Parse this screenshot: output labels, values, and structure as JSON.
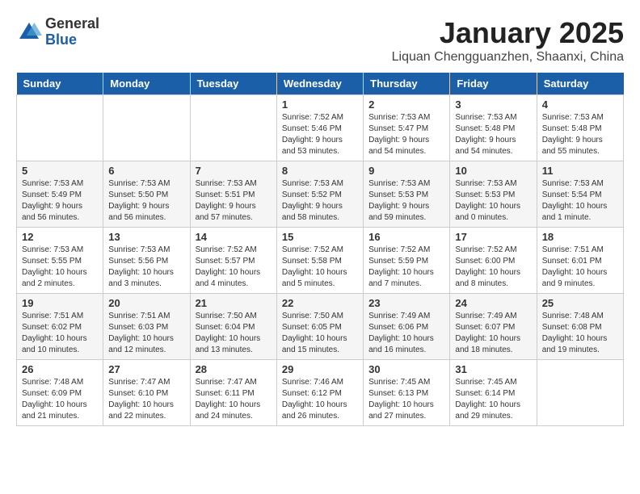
{
  "logo": {
    "general": "General",
    "blue": "Blue"
  },
  "title": "January 2025",
  "subtitle": "Liquan Chengguanzhen, Shaanxi, China",
  "headers": [
    "Sunday",
    "Monday",
    "Tuesday",
    "Wednesday",
    "Thursday",
    "Friday",
    "Saturday"
  ],
  "weeks": [
    [
      {
        "day": "",
        "info": ""
      },
      {
        "day": "",
        "info": ""
      },
      {
        "day": "",
        "info": ""
      },
      {
        "day": "1",
        "info": "Sunrise: 7:52 AM\nSunset: 5:46 PM\nDaylight: 9 hours\nand 53 minutes."
      },
      {
        "day": "2",
        "info": "Sunrise: 7:53 AM\nSunset: 5:47 PM\nDaylight: 9 hours\nand 54 minutes."
      },
      {
        "day": "3",
        "info": "Sunrise: 7:53 AM\nSunset: 5:48 PM\nDaylight: 9 hours\nand 54 minutes."
      },
      {
        "day": "4",
        "info": "Sunrise: 7:53 AM\nSunset: 5:48 PM\nDaylight: 9 hours\nand 55 minutes."
      }
    ],
    [
      {
        "day": "5",
        "info": "Sunrise: 7:53 AM\nSunset: 5:49 PM\nDaylight: 9 hours\nand 56 minutes."
      },
      {
        "day": "6",
        "info": "Sunrise: 7:53 AM\nSunset: 5:50 PM\nDaylight: 9 hours\nand 56 minutes."
      },
      {
        "day": "7",
        "info": "Sunrise: 7:53 AM\nSunset: 5:51 PM\nDaylight: 9 hours\nand 57 minutes."
      },
      {
        "day": "8",
        "info": "Sunrise: 7:53 AM\nSunset: 5:52 PM\nDaylight: 9 hours\nand 58 minutes."
      },
      {
        "day": "9",
        "info": "Sunrise: 7:53 AM\nSunset: 5:53 PM\nDaylight: 9 hours\nand 59 minutes."
      },
      {
        "day": "10",
        "info": "Sunrise: 7:53 AM\nSunset: 5:53 PM\nDaylight: 10 hours\nand 0 minutes."
      },
      {
        "day": "11",
        "info": "Sunrise: 7:53 AM\nSunset: 5:54 PM\nDaylight: 10 hours\nand 1 minute."
      }
    ],
    [
      {
        "day": "12",
        "info": "Sunrise: 7:53 AM\nSunset: 5:55 PM\nDaylight: 10 hours\nand 2 minutes."
      },
      {
        "day": "13",
        "info": "Sunrise: 7:53 AM\nSunset: 5:56 PM\nDaylight: 10 hours\nand 3 minutes."
      },
      {
        "day": "14",
        "info": "Sunrise: 7:52 AM\nSunset: 5:57 PM\nDaylight: 10 hours\nand 4 minutes."
      },
      {
        "day": "15",
        "info": "Sunrise: 7:52 AM\nSunset: 5:58 PM\nDaylight: 10 hours\nand 5 minutes."
      },
      {
        "day": "16",
        "info": "Sunrise: 7:52 AM\nSunset: 5:59 PM\nDaylight: 10 hours\nand 7 minutes."
      },
      {
        "day": "17",
        "info": "Sunrise: 7:52 AM\nSunset: 6:00 PM\nDaylight: 10 hours\nand 8 minutes."
      },
      {
        "day": "18",
        "info": "Sunrise: 7:51 AM\nSunset: 6:01 PM\nDaylight: 10 hours\nand 9 minutes."
      }
    ],
    [
      {
        "day": "19",
        "info": "Sunrise: 7:51 AM\nSunset: 6:02 PM\nDaylight: 10 hours\nand 10 minutes."
      },
      {
        "day": "20",
        "info": "Sunrise: 7:51 AM\nSunset: 6:03 PM\nDaylight: 10 hours\nand 12 minutes."
      },
      {
        "day": "21",
        "info": "Sunrise: 7:50 AM\nSunset: 6:04 PM\nDaylight: 10 hours\nand 13 minutes."
      },
      {
        "day": "22",
        "info": "Sunrise: 7:50 AM\nSunset: 6:05 PM\nDaylight: 10 hours\nand 15 minutes."
      },
      {
        "day": "23",
        "info": "Sunrise: 7:49 AM\nSunset: 6:06 PM\nDaylight: 10 hours\nand 16 minutes."
      },
      {
        "day": "24",
        "info": "Sunrise: 7:49 AM\nSunset: 6:07 PM\nDaylight: 10 hours\nand 18 minutes."
      },
      {
        "day": "25",
        "info": "Sunrise: 7:48 AM\nSunset: 6:08 PM\nDaylight: 10 hours\nand 19 minutes."
      }
    ],
    [
      {
        "day": "26",
        "info": "Sunrise: 7:48 AM\nSunset: 6:09 PM\nDaylight: 10 hours\nand 21 minutes."
      },
      {
        "day": "27",
        "info": "Sunrise: 7:47 AM\nSunset: 6:10 PM\nDaylight: 10 hours\nand 22 minutes."
      },
      {
        "day": "28",
        "info": "Sunrise: 7:47 AM\nSunset: 6:11 PM\nDaylight: 10 hours\nand 24 minutes."
      },
      {
        "day": "29",
        "info": "Sunrise: 7:46 AM\nSunset: 6:12 PM\nDaylight: 10 hours\nand 26 minutes."
      },
      {
        "day": "30",
        "info": "Sunrise: 7:45 AM\nSunset: 6:13 PM\nDaylight: 10 hours\nand 27 minutes."
      },
      {
        "day": "31",
        "info": "Sunrise: 7:45 AM\nSunset: 6:14 PM\nDaylight: 10 hours\nand 29 minutes."
      },
      {
        "day": "",
        "info": ""
      }
    ]
  ]
}
